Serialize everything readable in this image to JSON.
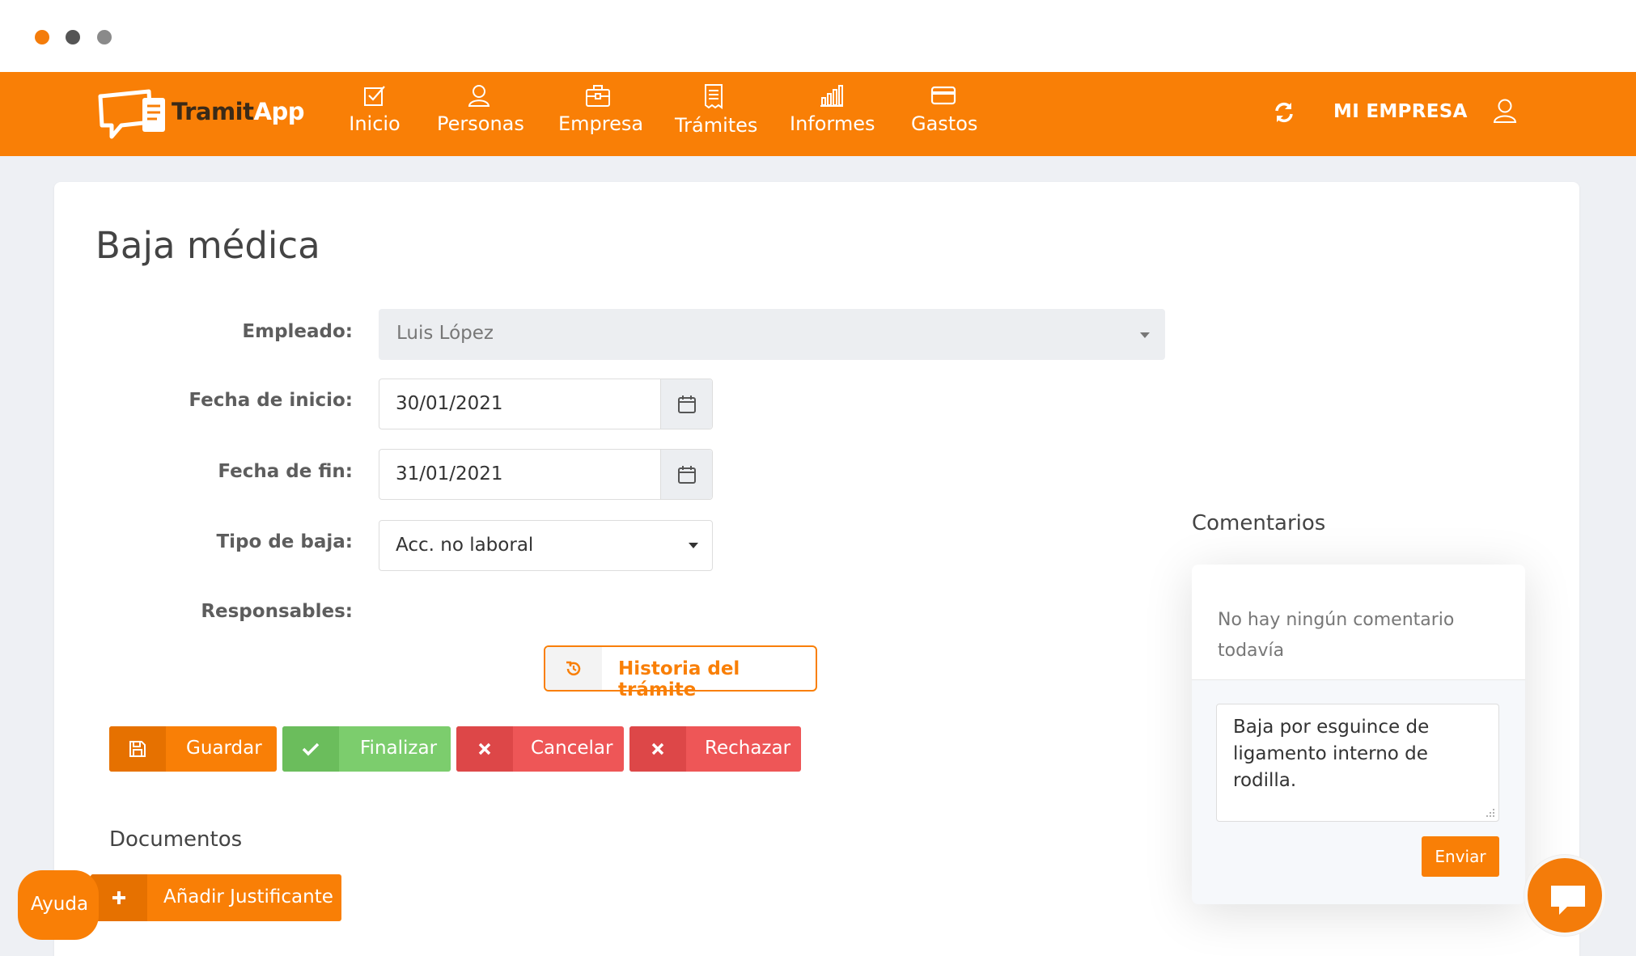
{
  "brand": {
    "name_part1": "Tramit",
    "name_part2": "App",
    "color": "#f97f06"
  },
  "nav": {
    "items": [
      {
        "label": "Inicio",
        "icon": "check-square-icon"
      },
      {
        "label": "Personas",
        "icon": "user-icon"
      },
      {
        "label": "Empresa",
        "icon": "briefcase-icon"
      },
      {
        "label": "Trámites",
        "icon": "receipt-icon"
      },
      {
        "label": "Informes",
        "icon": "bar-chart-icon"
      },
      {
        "label": "Gastos",
        "icon": "credit-card-icon"
      }
    ],
    "company_label": "MI EMPRESA",
    "refresh_icon": "refresh-icon",
    "profile_icon": "user-icon"
  },
  "page": {
    "title": "Baja médica"
  },
  "form": {
    "empleado": {
      "label": "Empleado:",
      "value": "Luis López"
    },
    "fecha_inicio": {
      "label": "Fecha de inicio:",
      "value": "30/01/2021"
    },
    "fecha_fin": {
      "label": "Fecha de fin:",
      "value": "31/01/2021"
    },
    "tipo_baja": {
      "label": "Tipo de baja:",
      "value": "Acc. no laboral"
    },
    "responsables": {
      "label": "Responsables:"
    }
  },
  "history_button": {
    "label": "Historia del trámite"
  },
  "actions": {
    "save": "Guardar",
    "finish": "Finalizar",
    "cancel": "Cancelar",
    "reject": "Rechazar"
  },
  "documents": {
    "title": "Documentos",
    "add_button": "Añadir Justificante"
  },
  "help": {
    "label": "Ayuda"
  },
  "comments": {
    "title": "Comentarios",
    "empty": "No hay ningún comentario todavía",
    "draft": "Baja por esguince de ligamento interno de rodilla.",
    "send": "Enviar"
  }
}
